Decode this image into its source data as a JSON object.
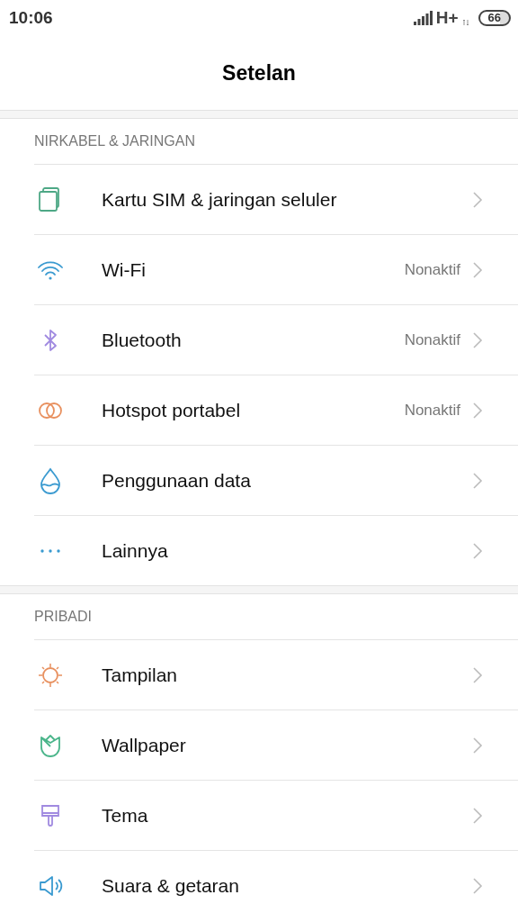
{
  "status_bar": {
    "time": "10:06",
    "network": "H+",
    "battery": "66"
  },
  "header": {
    "title": "Setelan"
  },
  "sections": [
    {
      "title": "NIRKABEL & JARINGAN",
      "items": [
        {
          "kind": "sim",
          "label": "Kartu SIM & jaringan seluler"
        },
        {
          "kind": "wifi",
          "label": "Wi-Fi",
          "value": "Nonaktif"
        },
        {
          "kind": "bluetooth",
          "label": "Bluetooth",
          "value": "Nonaktif"
        },
        {
          "kind": "hotspot",
          "label": "Hotspot portabel",
          "value": "Nonaktif"
        },
        {
          "kind": "data",
          "label": "Penggunaan data"
        },
        {
          "kind": "more",
          "label": "Lainnya"
        }
      ]
    },
    {
      "title": "PRIBADI",
      "items": [
        {
          "kind": "display",
          "label": "Tampilan"
        },
        {
          "kind": "wallpaper",
          "label": "Wallpaper"
        },
        {
          "kind": "theme",
          "label": "Tema"
        },
        {
          "kind": "sound",
          "label": "Suara & getaran"
        }
      ]
    }
  ]
}
